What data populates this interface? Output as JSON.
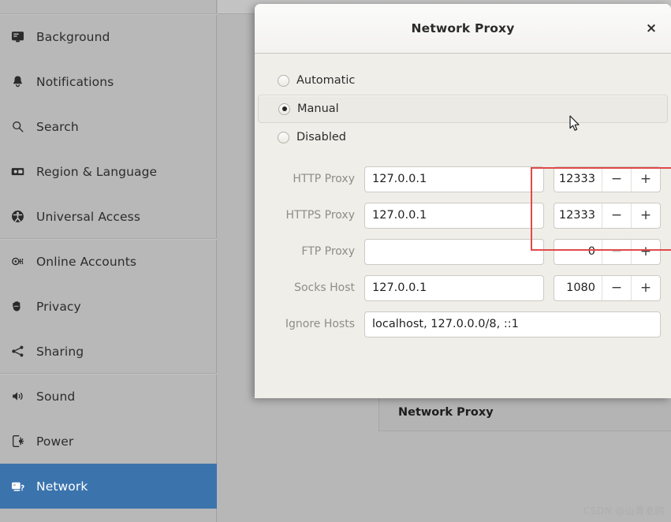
{
  "sidebar": {
    "items": [
      {
        "label": "Background",
        "icon": "monitor-icon",
        "selected": false,
        "divider_above": true
      },
      {
        "label": "Notifications",
        "icon": "bell-icon",
        "selected": false,
        "divider_above": false
      },
      {
        "label": "Search",
        "icon": "magnifier-icon",
        "selected": false,
        "divider_above": false
      },
      {
        "label": "Region & Language",
        "icon": "flag-icon",
        "selected": false,
        "divider_above": false
      },
      {
        "label": "Universal Access",
        "icon": "accessibility-icon",
        "selected": false,
        "divider_above": false
      },
      {
        "label": "Online Accounts",
        "icon": "online-accounts-icon",
        "selected": false,
        "divider_above": true
      },
      {
        "label": "Privacy",
        "icon": "privacy-hand-icon",
        "selected": false,
        "divider_above": false
      },
      {
        "label": "Sharing",
        "icon": "share-nodes-icon",
        "selected": false,
        "divider_above": false
      },
      {
        "label": "Sound",
        "icon": "speaker-icon",
        "selected": false,
        "divider_above": true
      },
      {
        "label": "Power",
        "icon": "power-plug-icon",
        "selected": false,
        "divider_above": false
      },
      {
        "label": "Network",
        "icon": "network-icon",
        "selected": true,
        "divider_above": false
      }
    ],
    "selected_color": "#3b74ad"
  },
  "background_pane": {
    "proxy_row_label": "Network Proxy",
    "watermark": "CSDN @山青老鸥"
  },
  "dialog": {
    "title": "Network Proxy",
    "close_label": "×",
    "method": {
      "options": [
        {
          "label": "Automatic",
          "selected": false,
          "highlighted": false
        },
        {
          "label": "Manual",
          "selected": true,
          "highlighted": true
        },
        {
          "label": "Disabled",
          "selected": false,
          "highlighted": false
        }
      ]
    },
    "fields": [
      {
        "label": "HTTP Proxy",
        "host": "127.0.0.1",
        "host_placeholder": "",
        "port": "12333",
        "has_port": true,
        "minus_label": "−",
        "plus_label": "+",
        "minus_dim": false,
        "annotated": true
      },
      {
        "label": "HTTPS Proxy",
        "host": "127.0.0.1",
        "host_placeholder": "",
        "port": "12333",
        "has_port": true,
        "minus_label": "−",
        "plus_label": "+",
        "minus_dim": false,
        "annotated": true
      },
      {
        "label": "FTP Proxy",
        "host": "",
        "host_placeholder": "",
        "port": "0",
        "has_port": true,
        "minus_label": "−",
        "plus_label": "+",
        "minus_dim": true,
        "annotated": false
      },
      {
        "label": "Socks Host",
        "host": "127.0.0.1",
        "host_placeholder": "",
        "port": "1080",
        "has_port": true,
        "minus_label": "−",
        "plus_label": "+",
        "minus_dim": false,
        "annotated": false
      },
      {
        "label": "Ignore Hosts",
        "host": "localhost, 127.0.0.0/8, ::1",
        "host_placeholder": "",
        "port": "",
        "has_port": false,
        "minus_label": "",
        "plus_label": "",
        "minus_dim": false,
        "annotated": false
      }
    ]
  },
  "annotation": {
    "color": "#e04a4a"
  }
}
